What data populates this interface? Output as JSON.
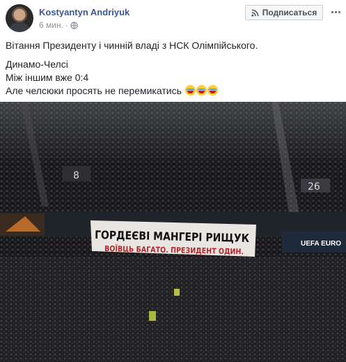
{
  "post": {
    "author": "Kostyantyn Andriyuk",
    "time": "6 мин.",
    "separator": "·",
    "subscribe_label": "Подписаться",
    "lines": [
      "Вітання Президенту і чинній владі з НСК Олімпійського.",
      "Динамо-Челсі",
      "Між іншим вже 0:4",
      "Але челсюки просять не перемикатись"
    ],
    "emoji_icon": "laughing-tears-emoji"
  },
  "photo": {
    "banner_line1": "ГОРДЕЄВІ МАНГЕРІ РИЩУК",
    "banner_line2": "ВОЇВЦЬ БАГАТО. ПРЕЗИДЕНТ ОДИН.",
    "sector_left": "8",
    "sector_right": "26",
    "ad_right": "UEFA EURO"
  },
  "colors": {
    "link": "#365899",
    "meta": "#90949c",
    "text": "#1d2129"
  }
}
